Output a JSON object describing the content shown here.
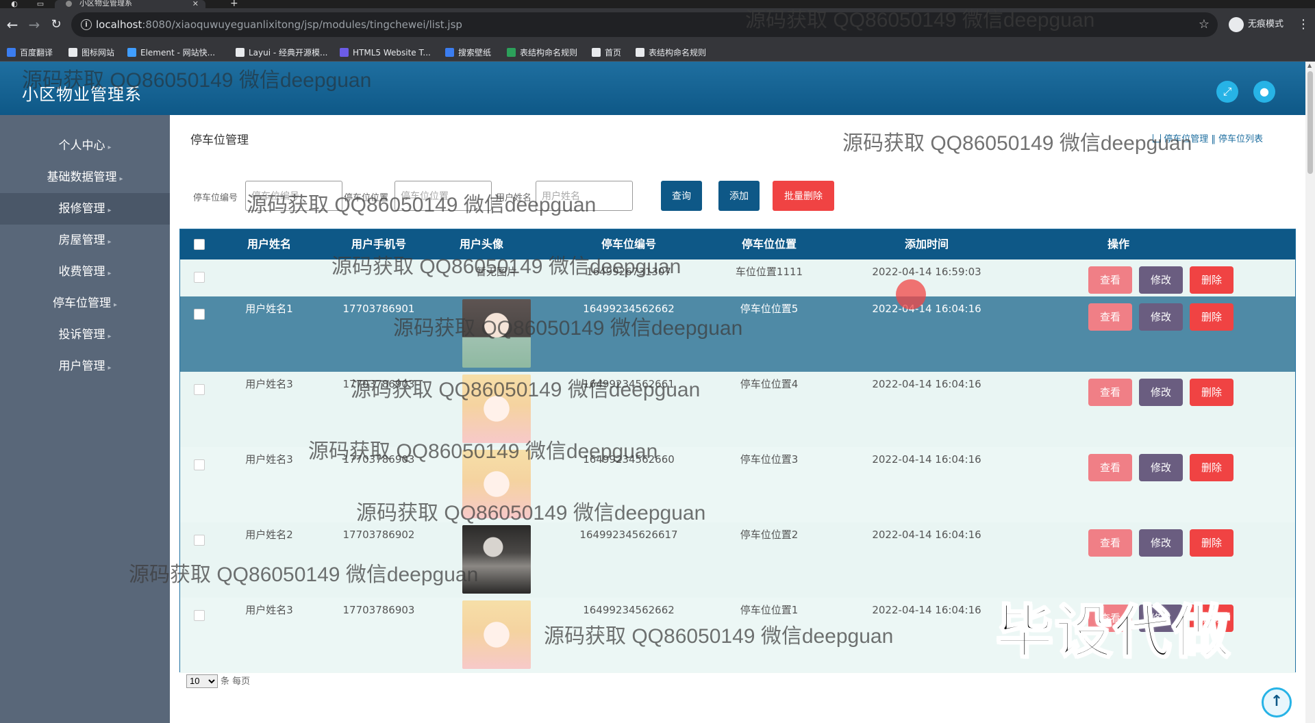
{
  "browser": {
    "tab_title": "小区物业管理系",
    "url_host": "localhost",
    "url_rest": ":8080/xiaoquwuyeguanlixitong/jsp/modules/tingchewei/list.jsp",
    "incognito_label": "无痕模式",
    "bookmarks": [
      {
        "label": "百度翻译",
        "color": "#3b7df0"
      },
      {
        "label": "图标网站",
        "color": "#e8eaed"
      },
      {
        "label": "Element - 网站快...",
        "color": "#409eff"
      },
      {
        "label": "Layui - 经典开源模...",
        "color": "#e8eaed"
      },
      {
        "label": "HTML5 Website T...",
        "color": "#6c5ce7"
      },
      {
        "label": "搜索壁纸",
        "color": "#3b7df0"
      },
      {
        "label": "表结构命名规则",
        "color": "#2ca05a"
      },
      {
        "label": "首页",
        "color": "#e8eaed"
      },
      {
        "label": "表结构命名规则",
        "color": "#e8eaed"
      }
    ]
  },
  "app": {
    "title": "小区物业管理系"
  },
  "sidebar": {
    "items": [
      {
        "label": "个人中心"
      },
      {
        "label": "基础数据管理"
      },
      {
        "label": "报修管理"
      },
      {
        "label": "房屋管理"
      },
      {
        "label": "收费管理"
      },
      {
        "label": "停车位管理"
      },
      {
        "label": "投诉管理"
      },
      {
        "label": "用户管理"
      }
    ]
  },
  "page": {
    "title": "停车位管理",
    "breadcrumb": [
      "停车位管理",
      "停车位列表"
    ]
  },
  "filters": [
    {
      "label": "停车位编号",
      "placeholder": "停车位编号"
    },
    {
      "label": "停车位位置",
      "placeholder": "停车位位置"
    },
    {
      "label": "用户姓名",
      "placeholder": "用户姓名"
    }
  ],
  "buttons": {
    "search": "查询",
    "add": "添加",
    "batch_delete": "批量删除"
  },
  "table": {
    "headers": [
      "用户姓名",
      "用户手机号",
      "用户头像",
      "停车位编号",
      "停车位位置",
      "添加时间",
      "操作"
    ],
    "rows": [
      {
        "name": "",
        "phone": "",
        "avatar": "暂无图片",
        "avatar_img": "",
        "code": "1649926731307",
        "location": "车位位置1111",
        "time": "2022-04-14 16:59:03"
      },
      {
        "name": "用户姓名1",
        "phone": "17703786901",
        "avatar": "",
        "avatar_img": "girl-dark",
        "code": "16499234562662",
        "location": "停车位位置5",
        "time": "2022-04-14 16:04:16"
      },
      {
        "name": "用户姓名3",
        "phone": "17703786903",
        "avatar": "",
        "avatar_img": "girl-pink",
        "code": "16499234562661",
        "location": "停车位位置4",
        "time": "2022-04-14 16:04:16"
      },
      {
        "name": "用户姓名3",
        "phone": "17703786903",
        "avatar": "",
        "avatar_img": "girl-pink",
        "code": "16499234562660",
        "location": "停车位位置3",
        "time": "2022-04-14 16:04:16"
      },
      {
        "name": "用户姓名2",
        "phone": "17703786902",
        "avatar": "",
        "avatar_img": "man",
        "code": "164992345626617",
        "location": "停车位位置2",
        "time": "2022-04-14 16:04:16"
      },
      {
        "name": "用户姓名3",
        "phone": "17703786903",
        "avatar": "",
        "avatar_img": "girl-pink",
        "code": "16499234562662",
        "location": "停车位位置1",
        "time": "2022-04-14 16:04:16"
      }
    ],
    "actions": {
      "view": "查看",
      "edit": "修改",
      "delete": "删除"
    }
  },
  "pager": {
    "page_size": "10",
    "suffix": "条 每页"
  },
  "overlays": {
    "watermark": "源码获取 QQ86050149 微信deepguan",
    "promo": "毕设代做"
  },
  "colors": {
    "header_blue": "#0e5887",
    "sidebar": "#596779",
    "view_btn": "#f07f86",
    "edit_btn": "#6a5d80",
    "delete_btn": "#f04343"
  }
}
